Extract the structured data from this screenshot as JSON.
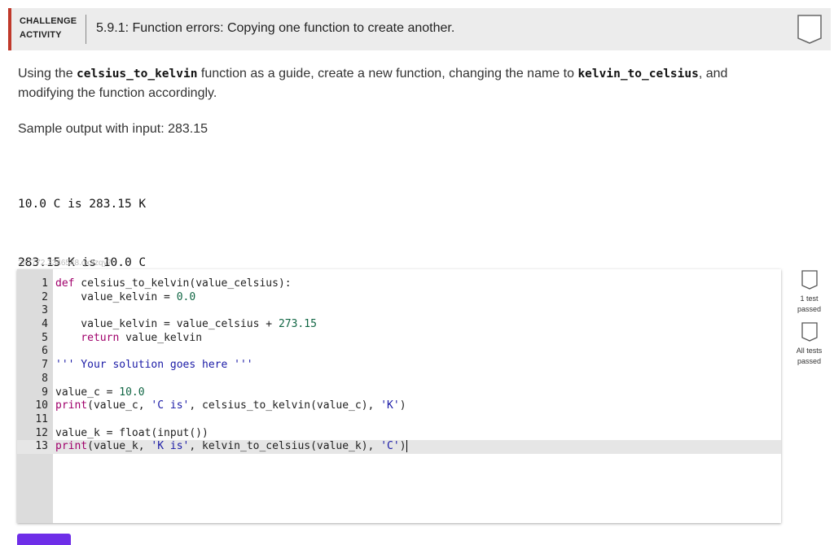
{
  "header": {
    "label_line1": "CHALLENGE",
    "label_line2": "ACTIVITY",
    "title": "5.9.1: Function errors: Copying one function to create another."
  },
  "instructions": {
    "part1": "Using the ",
    "func1": "celsius_to_kelvin",
    "part2": " function as a guide, create a new function, changing the name to ",
    "func2": "kelvin_to_celsius",
    "part3": ", and modifying the function accordingly."
  },
  "sample": {
    "label": "Sample output with input: 283.15",
    "lines": [
      "10.0 C is 283.15 K",
      "283.15 K is 10.0 C"
    ]
  },
  "activity_id": "247772.2346548.qx3zqy7",
  "editor": {
    "line_numbers": [
      "1",
      "2",
      "3",
      "4",
      "5",
      "6",
      "7",
      "8",
      "9",
      "10",
      "11",
      "12",
      "13"
    ],
    "active_line": 13,
    "tokens": {
      "l1_def": "def",
      "l1_rest": " celsius_to_kelvin(value_celsius):",
      "l2_a": "    value_kelvin = ",
      "l2_num": "0.0",
      "l4_a": "    value_kelvin = value_celsius + ",
      "l4_num": "273.15",
      "l5_ret": "    return",
      "l5_rest": " value_kelvin",
      "l7_str": "''' Your solution goes here '''",
      "l9_a": "value_c = ",
      "l9_num": "10.0",
      "l10_print": "print",
      "l10_a": "(value_c, ",
      "l10_s1": "'C is'",
      "l10_b": ", celsius_to_kelvin(value_c), ",
      "l10_s2": "'K'",
      "l10_c": ")",
      "l12_a": "value_k = float(input())",
      "l13_print": "print",
      "l13_a": "(value_k, ",
      "l13_s1": "'K is'",
      "l13_b": ", kelvin_to_celsius(value_k), ",
      "l13_s2": "'C'",
      "l13_c": ")"
    }
  },
  "tests": {
    "test1_line1": "1 test",
    "test1_line2": "passed",
    "test2_line1": "All tests",
    "test2_line2": "passed"
  },
  "icons": {
    "badge": "shield-outline-icon",
    "test1": "shield-outline-icon",
    "test2": "shield-outline-icon"
  },
  "colors": {
    "accent_bar": "#c0392b",
    "run_button": "#6e2ee8"
  }
}
